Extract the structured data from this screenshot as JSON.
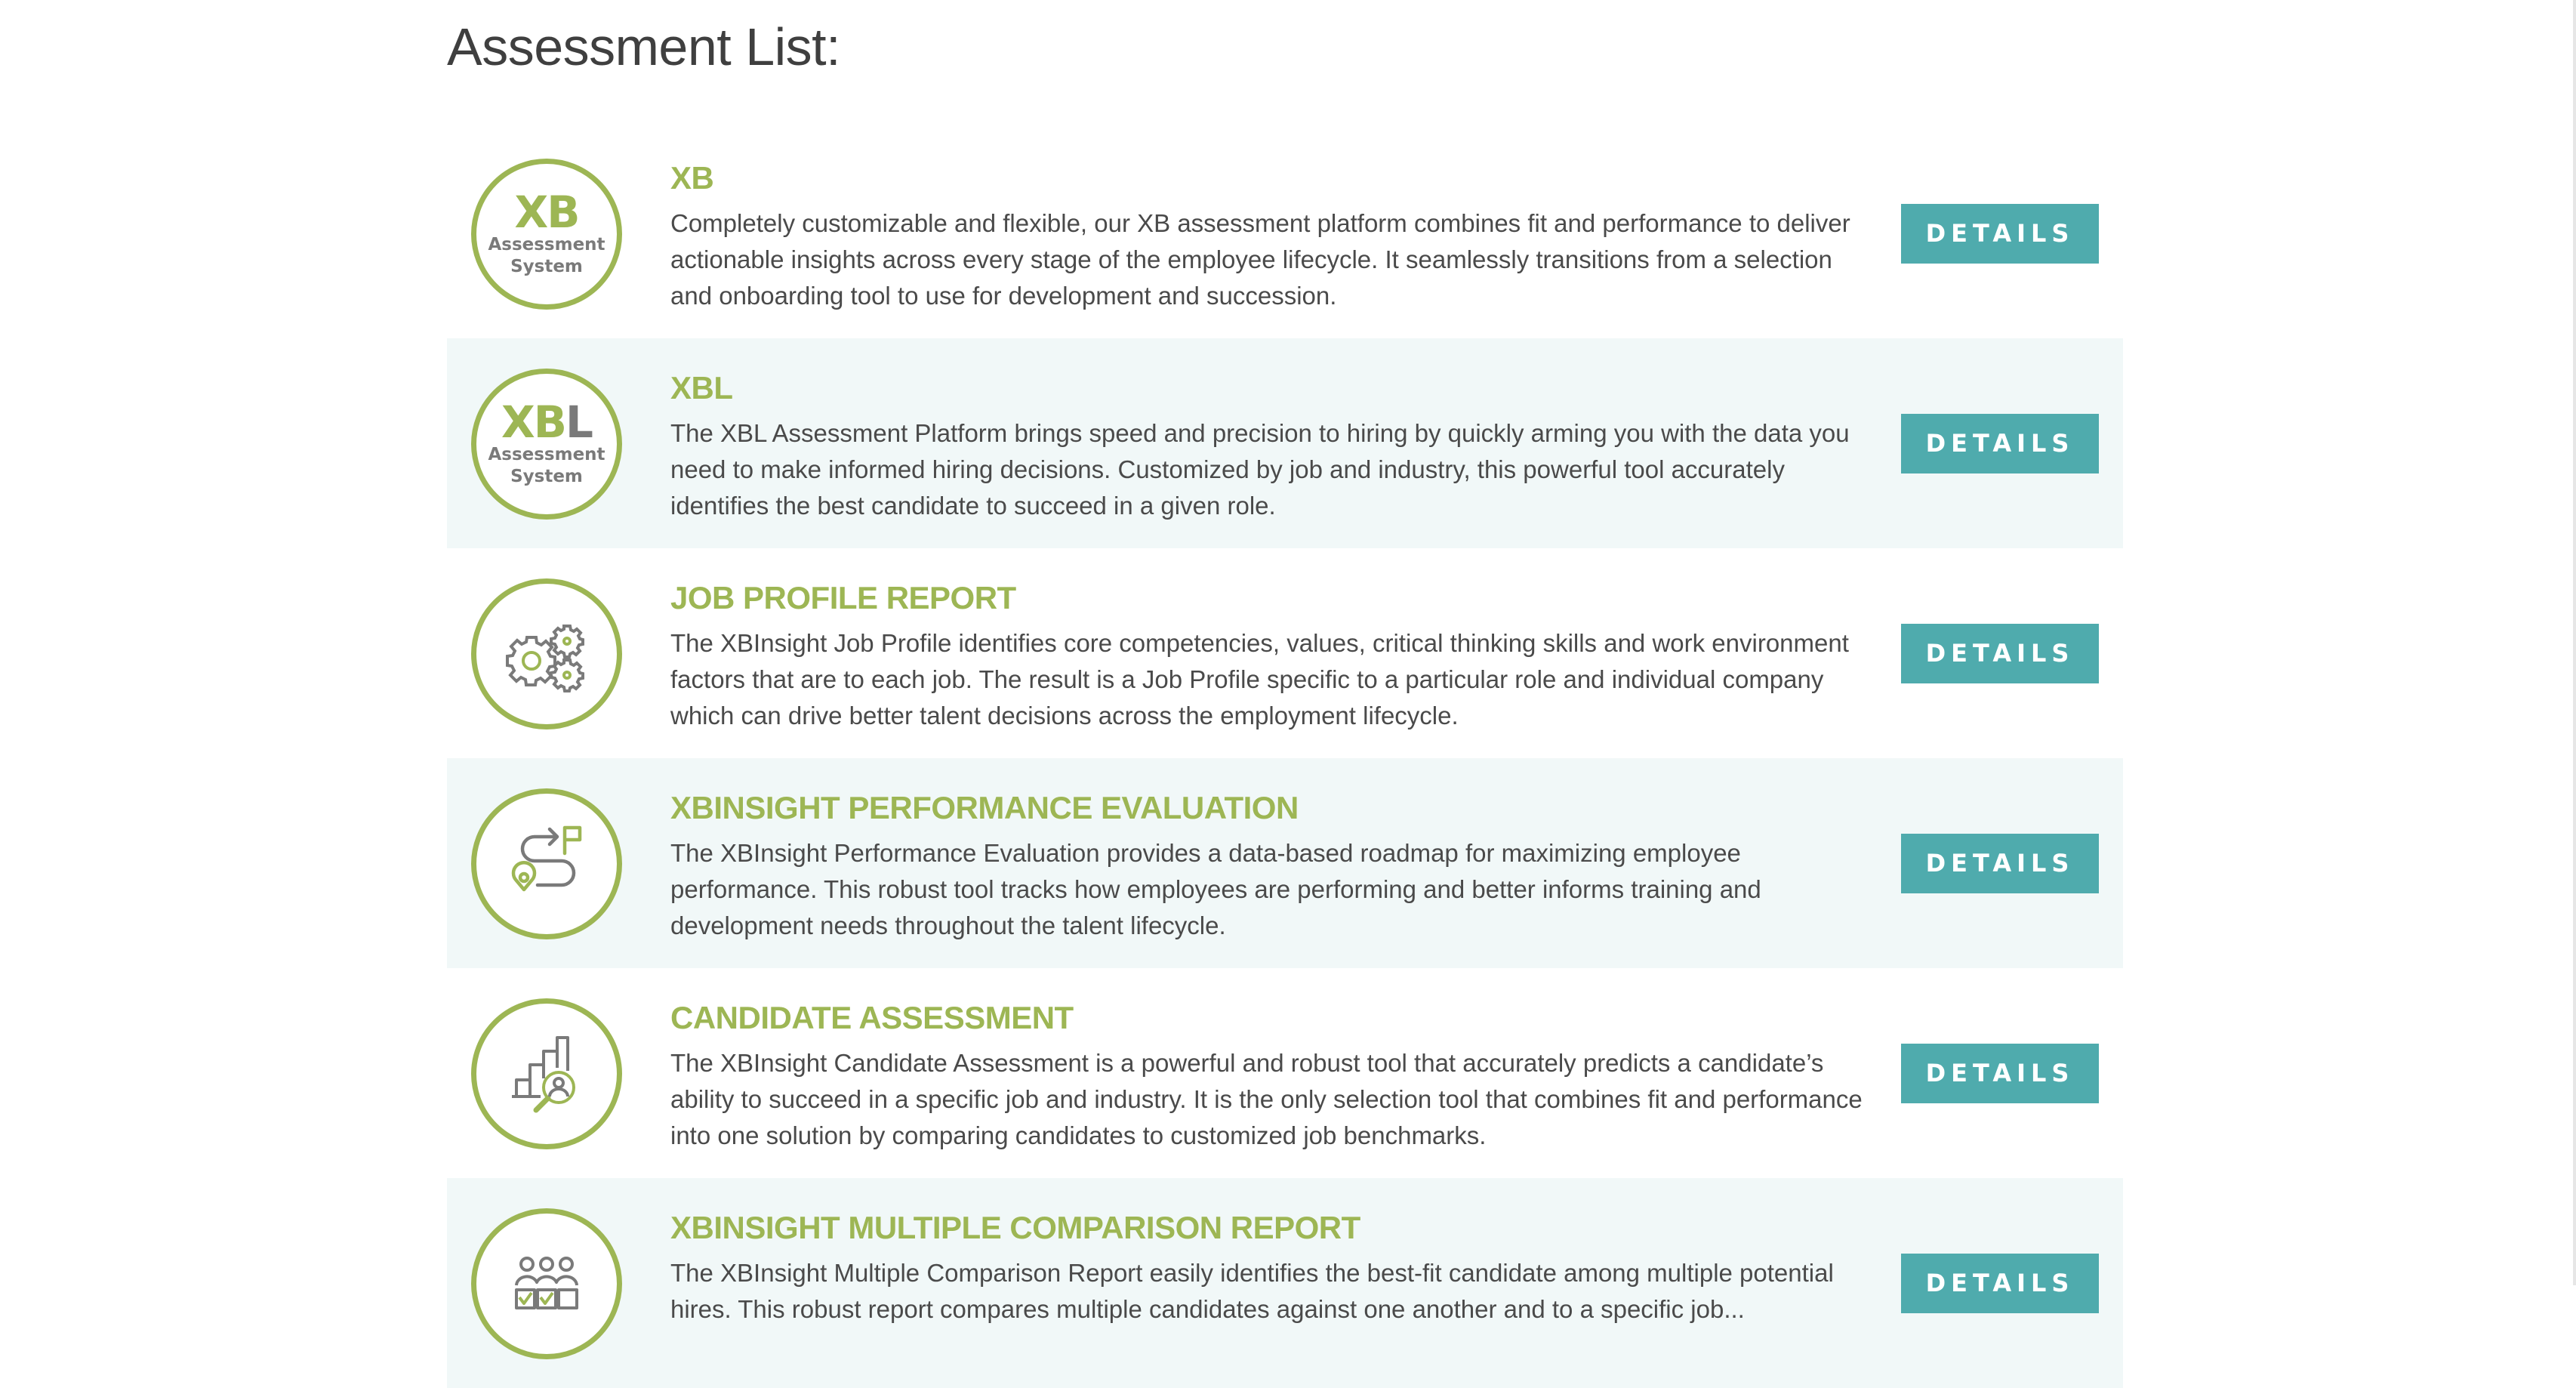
{
  "page": {
    "title": "Assessment List:"
  },
  "colors": {
    "accent_green": "#9db654",
    "button_teal": "#4fabad",
    "alt_row_bg": "#f1f8f8",
    "icon_gray": "#7a7a7a"
  },
  "assessments": [
    {
      "icon": "xb-assessment-system-logo",
      "badge_main": "XB",
      "badge_suffix": "",
      "badge_line1": "Assessment",
      "badge_line2": "System",
      "title": "XB",
      "description": "Completely customizable and flexible, our XB assessment platform combines fit and performance to deliver actionable insights across every stage of the employee lifecycle. It seamlessly transitions from a selection and onboarding tool to use for development and succession.",
      "button_label": "DETAILS"
    },
    {
      "icon": "xbl-assessment-system-logo",
      "badge_main": "XB",
      "badge_suffix": "L",
      "badge_line1": "Assessment",
      "badge_line2": "System",
      "title": "XBL",
      "description": "The XBL Assessment Platform brings speed and precision to hiring by quickly arming you with the data you need to make informed hiring decisions. Customized by job and industry, this powerful tool accurately identifies the best candidate to succeed in a given role.",
      "button_label": "DETAILS"
    },
    {
      "icon": "gears-icon",
      "title": "JOB PROFILE REPORT",
      "description": "The XBInsight Job Profile identifies core competencies, values, critical thinking skills and work environment factors that are to each job. The result is a Job Profile specific to a particular role and individual company which can drive better talent decisions across the employment lifecycle.",
      "button_label": "DETAILS"
    },
    {
      "icon": "roadmap-icon",
      "title": "XBINSIGHT PERFORMANCE EVALUATION",
      "description": "The XBInsight Performance Evaluation provides a data-based roadmap for maximizing employee performance. This robust tool tracks how employees are performing and better informs training and development needs throughout the talent lifecycle.",
      "button_label": "DETAILS"
    },
    {
      "icon": "chart-search-person-icon",
      "title": "CANDIDATE ASSESSMENT",
      "description": "The XBInsight Candidate Assessment is a powerful and robust tool that accurately predicts a candidate’s ability to succeed in a specific job and industry. It is the only selection tool that combines fit and performance into one solution by comparing candidates to customized job benchmarks.",
      "button_label": "DETAILS"
    },
    {
      "icon": "group-checklist-icon",
      "title": "XBINSIGHT MULTIPLE COMPARISON REPORT",
      "description": "The XBInsight Multiple Comparison Report easily identifies the best-fit candidate among multiple potential hires. This robust report compares multiple candidates against one another and to a specific job...",
      "button_label": "DETAILS"
    }
  ]
}
